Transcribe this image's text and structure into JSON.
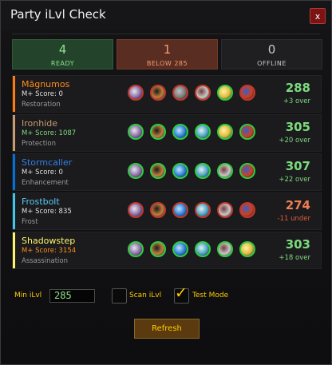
{
  "window": {
    "title": "Party iLvl Check",
    "close_label": "x"
  },
  "summary": {
    "ready": {
      "count": "4",
      "label": "READY"
    },
    "below": {
      "count": "1",
      "label": "BELOW 285"
    },
    "offline": {
      "count": "0",
      "label": "OFFLINE"
    }
  },
  "players": [
    {
      "name": "Māgnumos",
      "mplus": "M+ Score: 0",
      "spec": "Restoration",
      "ilvl": "288",
      "diff": "+3 over",
      "class_color": "#ff7c0a",
      "name_color": "#ff8a1a",
      "mplus_color": "#e0e0e0",
      "ilvl_color": "#7cda7c",
      "diff_color": "#7cda7c",
      "icons": [
        "figure-icon",
        "sword-icon",
        "chain-icon",
        "skull-icon",
        "idol-icon",
        "totem-icon"
      ],
      "icon_rings": [
        "#c0392b",
        "#c0392b",
        "#c0392b",
        "#c0392b",
        "#2ecc40",
        "#c0392b"
      ]
    },
    {
      "name": "Ironhide",
      "mplus": "M+ Score: 1087",
      "spec": "Protection",
      "ilvl": "305",
      "diff": "+20 over",
      "class_color": "#c69b6d",
      "name_color": "#c69b6d",
      "mplus_color": "#7cda7c",
      "ilvl_color": "#7cda7c",
      "diff_color": "#7cda7c",
      "icons": [
        "figure-icon",
        "sword-icon",
        "orb-icon",
        "eye-icon",
        "idol-icon",
        "totem-icon"
      ],
      "icon_rings": [
        "#2ecc40",
        "#2ecc40",
        "#2ecc40",
        "#2ecc40",
        "#2ecc40",
        "#2ecc40"
      ]
    },
    {
      "name": "Stormcaller",
      "mplus": "M+ Score: 0",
      "spec": "Enhancement",
      "ilvl": "307",
      "diff": "+22 over",
      "class_color": "#0070dd",
      "name_color": "#2f7fe0",
      "mplus_color": "#e0e0e0",
      "ilvl_color": "#7cda7c",
      "diff_color": "#7cda7c",
      "icons": [
        "figure-icon",
        "sword-icon",
        "orb-icon",
        "eye-icon",
        "skull-icon",
        "totem-icon"
      ],
      "icon_rings": [
        "#2ecc40",
        "#2ecc40",
        "#2ecc40",
        "#2ecc40",
        "#2ecc40",
        "#2ecc40"
      ]
    },
    {
      "name": "Frostbolt",
      "mplus": "M+ Score: 835",
      "spec": "Frost",
      "ilvl": "274",
      "diff": "-11 under",
      "class_color": "#3fc7eb",
      "name_color": "#5ac8ec",
      "mplus_color": "#e0e0e0",
      "ilvl_color": "#f07d50",
      "diff_color": "#e05a3a",
      "icons": [
        "figure-icon",
        "sword-icon",
        "orb-icon",
        "eye-icon",
        "skull-icon",
        "totem-icon"
      ],
      "icon_rings": [
        "#c0392b",
        "#c0392b",
        "#c0392b",
        "#c0392b",
        "#c0392b",
        "#c0392b"
      ]
    },
    {
      "name": "Shadowstep",
      "mplus": "M+ Score: 3154",
      "spec": "Assassination",
      "ilvl": "303",
      "diff": "+18 over",
      "class_color": "#fff468",
      "name_color": "#fff468",
      "mplus_color": "#ff8c1a",
      "ilvl_color": "#7cda7c",
      "diff_color": "#7cda7c",
      "icons": [
        "figure-icon",
        "sword-icon",
        "orb-icon",
        "eye-icon",
        "skull-icon",
        "idol-icon"
      ],
      "icon_rings": [
        "#2ecc40",
        "#2ecc40",
        "#2ecc40",
        "#2ecc40",
        "#2ecc40",
        "#2ecc40"
      ]
    }
  ],
  "controls": {
    "min_ilvl_label": "Min iLvl",
    "min_ilvl_value": "285",
    "scan_label": "Scan iLvl",
    "scan_checked": false,
    "test_label": "Test Mode",
    "test_checked": true,
    "refresh_label": "Refresh"
  }
}
